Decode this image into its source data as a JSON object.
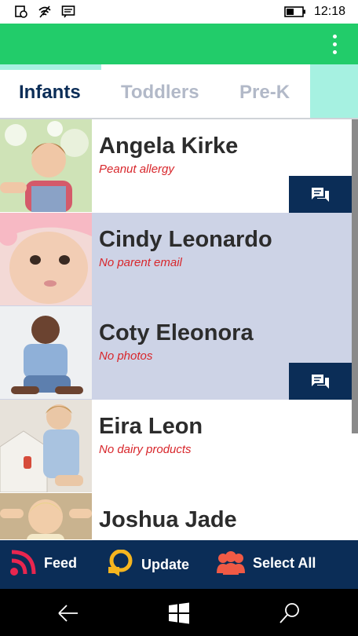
{
  "status_bar": {
    "time": "12:18"
  },
  "app_bar": {
    "menu_icon": "more-vertical-icon",
    "color": "#22cc6a"
  },
  "tabs": [
    {
      "label": "Infants",
      "active": true
    },
    {
      "label": "Toddlers",
      "active": false
    },
    {
      "label": "Pre-K",
      "active": false
    }
  ],
  "children": [
    {
      "name": "Angela Kirke",
      "note": "Peanut allergy",
      "has_message": true,
      "highlighted": false
    },
    {
      "name": "Cindy Leonardo",
      "note": "No parent email",
      "has_message": false,
      "highlighted": true
    },
    {
      "name": "Coty Eleonora",
      "note": "No photos",
      "has_message": true,
      "highlighted": true
    },
    {
      "name": "Eira Leon",
      "note": "No dairy products",
      "has_message": false,
      "highlighted": false
    },
    {
      "name": "Joshua Jade",
      "note": "",
      "has_message": false,
      "highlighted": false
    }
  ],
  "bottom_bar": {
    "feed": "Feed",
    "update": "Update",
    "select_all": "Select All"
  },
  "colors": {
    "highlight_row": "#cdd3e6",
    "navy": "#0b2d57",
    "note_red": "#d8262b",
    "accent_mint": "#a6f1e1"
  }
}
